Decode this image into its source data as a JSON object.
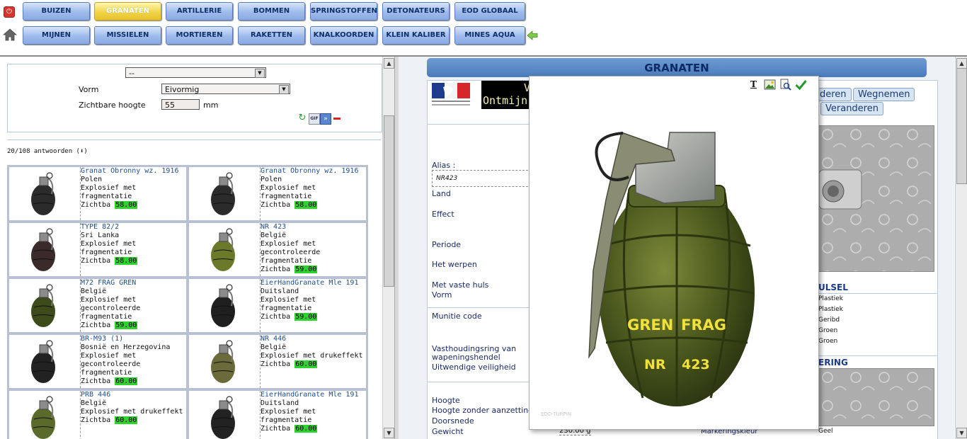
{
  "nav": {
    "row1": [
      "BUIZEN",
      "GRANATEN",
      "ARTILLERIE",
      "BOMMEN",
      "SPRINGSTOFFEN",
      "DETONATEURS",
      "EOD GLOBAAL"
    ],
    "row2": [
      "MIJNEN",
      "MISSIELEN",
      "MORTIEREN",
      "RAKETTEN",
      "KNALKOORDEN",
      "KLEIN KALIBER",
      "MINES AQUA"
    ],
    "active": "GRANATEN"
  },
  "filter": {
    "top_select": "--",
    "vorm_label": "Vorm",
    "vorm_value": "Eivormig",
    "hoogte_label": "Zichtbare hoogte",
    "hoogte_value": "55",
    "hoogte_unit": "mm"
  },
  "results": {
    "count": "20/108 antwoorden (⬇)",
    "items": [
      {
        "name": "Granat Obronny wz. 1916",
        "country": "Polen",
        "effect": "Explosief met",
        "effect2": "fragmentatie",
        "effect3": "",
        "zlabel": "Zichtba",
        "zvalue": "58.00"
      },
      {
        "name": "Granat Obronny wz. 1916",
        "country": "Polen",
        "effect": "Explosief met",
        "effect2": "fragmentatie",
        "effect3": "",
        "zlabel": "Zichtba",
        "zvalue": "58.00"
      },
      {
        "name": "TYPE 82/2",
        "country": "Sri Lanka",
        "effect": "Explosief met",
        "effect2": "fragmentatie",
        "effect3": "",
        "zlabel": "Zichtba",
        "zvalue": "58.00"
      },
      {
        "name": "NR 423",
        "country": "België",
        "effect": "Explosief met",
        "effect2": "gecontroleerde",
        "effect3": "fragmentatie",
        "zlabel": "Zichtba",
        "zvalue": "59.00"
      },
      {
        "name": "M72 FRAG GREN",
        "country": "België",
        "effect": "Explosief met",
        "effect2": "gecontroleerde",
        "effect3": "fragmentatie",
        "zlabel": "Zichtba",
        "zvalue": "59.00"
      },
      {
        "name": "EierHandGranate Mle 191",
        "country": "Duitsland",
        "effect": "Explosief met",
        "effect2": "fragmentatie",
        "effect3": "",
        "zlabel": "Zichtba",
        "zvalue": "59.00"
      },
      {
        "name": "BR-M93 (1)",
        "country": "Bosnië en Herzegovina",
        "effect": "Explosief met",
        "effect2": "gecontroleerde",
        "effect3": "fragmentatie",
        "zlabel": "Zichtba",
        "zvalue": "60.00"
      },
      {
        "name": "NR 446",
        "country": "België",
        "effect": "Explosief met drukeffekt",
        "effect2": "",
        "effect3": "",
        "zlabel": "Zichtba",
        "zvalue": "60.00"
      },
      {
        "name": "PRB 446",
        "country": "België",
        "effect": "Explosief met drukeffekt",
        "effect2": "",
        "effect3": "",
        "zlabel": "Zichtba",
        "zvalue": "60.00"
      },
      {
        "name": "EierHandGranate Mle 191",
        "country": "Duitsland",
        "effect": "Explosief met",
        "effect2": "fragmentatie",
        "effect3": "",
        "zlabel": "Zichtba",
        "zvalue": "60.00"
      }
    ]
  },
  "detail": {
    "header": "GRANATEN",
    "banner_line1": "V",
    "banner_line2": "Ontmijn",
    "alias_label": "Alias :",
    "alias_value": "NR423",
    "labels": [
      "Land",
      "Effect",
      "Periode",
      "Het werpen",
      "Met vaste huls",
      "Vorm",
      "Munitie code",
      "Vasthoudingsring van",
      "wapeningshendel",
      "Uitwendige veiligheid",
      "Hoogte",
      "Hoogte zonder aanzetting",
      "Doorsnede",
      "Gewicht"
    ],
    "gewicht_value": "230.00 g",
    "buttons": [
      "deren",
      "Wegnemen",
      "Veranderen"
    ],
    "sect_omhulsel": "ULSEL",
    "omhulsel_values": [
      "Plastiek",
      "Plastiek",
      "Geribd",
      "Groen",
      "Groen"
    ],
    "sect_markering": "ERING",
    "markering_label": "Markeringskleur",
    "markering_value": "Geel"
  },
  "popup": {
    "grenade_text1": "GREN",
    "grenade_text2": "FRAG",
    "grenade_text3": "NR",
    "grenade_text4": "423",
    "watermark": "EOD-TURPIN",
    "tool_text_icon": "T"
  },
  "colors": {
    "nav_blue": "#9fbbec",
    "nav_active": "#f1d44a",
    "highlight_green": "#2fd12f",
    "header_blue": "#4a7bbd"
  }
}
